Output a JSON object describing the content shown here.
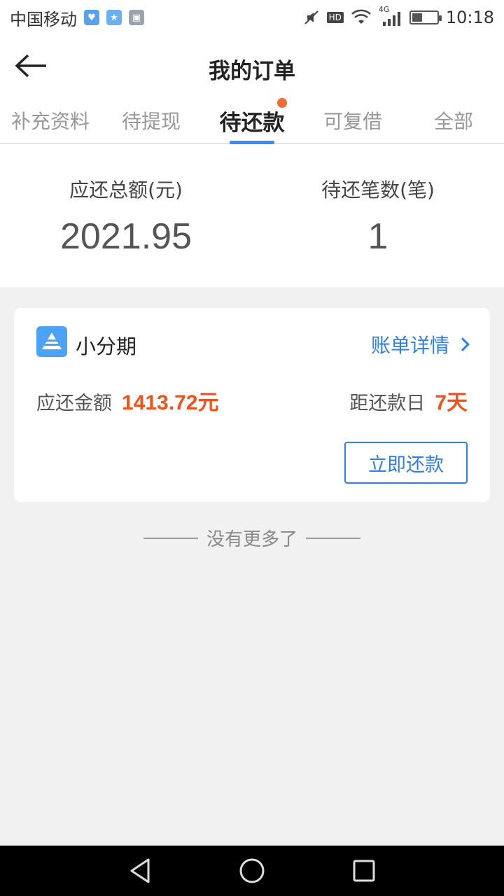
{
  "status_bar": {
    "carrier": "中国移动",
    "time": "10:18",
    "network": "4G",
    "hd": "HD",
    "battery_level": 0.4
  },
  "header": {
    "title": "我的订单"
  },
  "tabs": [
    {
      "label": "补充资料",
      "active": false
    },
    {
      "label": "待提现",
      "active": false
    },
    {
      "label": "待还款",
      "active": true,
      "badge_dot": true
    },
    {
      "label": "可复借",
      "active": false
    },
    {
      "label": "全部",
      "active": false
    }
  ],
  "summary": {
    "total_label": "应还总额(元)",
    "total_value": "2021.95",
    "count_label": "待还笔数(笔)",
    "count_value": "1"
  },
  "order_card": {
    "product_name": "小分期",
    "detail_link": "账单详情",
    "amount_label": "应还金额",
    "amount_value": "1413.72元",
    "days_label": "距还款日",
    "days_value": "7天",
    "repay_button": "立即还款"
  },
  "footer_text": "没有更多了",
  "colors": {
    "accent_blue": "#2f7fe8",
    "highlight_red": "#f0521e",
    "badge_dot": "#f26b35"
  }
}
